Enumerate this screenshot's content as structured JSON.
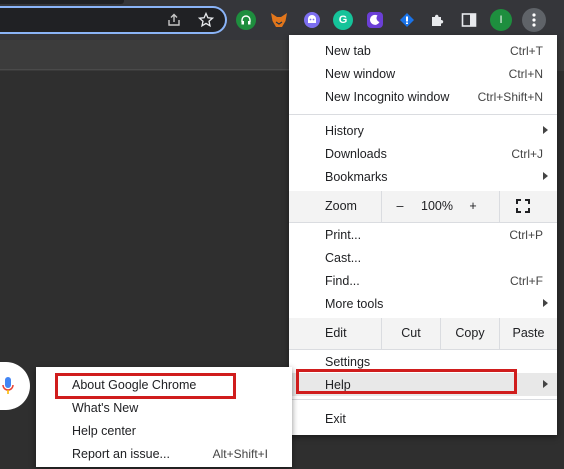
{
  "menu": {
    "items1": [
      {
        "label": "New tab",
        "shortcut": "Ctrl+T"
      },
      {
        "label": "New window",
        "shortcut": "Ctrl+N"
      },
      {
        "label": "New Incognito window",
        "shortcut": "Ctrl+Shift+N"
      }
    ],
    "items2": [
      {
        "label": "History",
        "shortcut": ""
      },
      {
        "label": "Downloads",
        "shortcut": "Ctrl+J"
      },
      {
        "label": "Bookmarks",
        "shortcut": ""
      }
    ],
    "zoom": {
      "label": "Zoom",
      "minus": "–",
      "value": "100%",
      "plus": "+"
    },
    "items3": [
      {
        "label": "Print...",
        "shortcut": "Ctrl+P"
      },
      {
        "label": "Cast...",
        "shortcut": ""
      },
      {
        "label": "Find...",
        "shortcut": "Ctrl+F"
      },
      {
        "label": "More tools",
        "shortcut": ""
      }
    ],
    "edit": {
      "label": "Edit",
      "cut": "Cut",
      "copy": "Copy",
      "paste": "Paste"
    },
    "settings": "Settings",
    "help": "Help",
    "exit": "Exit"
  },
  "help_submenu": [
    {
      "label": "About Google Chrome",
      "shortcut": ""
    },
    {
      "label": "What's New",
      "shortcut": ""
    },
    {
      "label": "Help center",
      "shortcut": ""
    },
    {
      "label": "Report an issue...",
      "shortcut": "Alt+Shift+I"
    }
  ],
  "toolbar": {
    "grammarly_letter": "G",
    "profile_letter": "I"
  },
  "icons": [
    "share-icon",
    "bookmark-star-icon",
    "extension-headphones-icon",
    "metamask-fox-icon",
    "extension-ghost-icon",
    "grammarly-icon",
    "extension-moon-icon",
    "extension-shield-icon",
    "extensions-puzzle-icon",
    "side-panel-icon",
    "profile-avatar",
    "chrome-menu-icon",
    "microphone-icon",
    "fullscreen-icon"
  ],
  "colors": {
    "highlight_box": "#d01d1d",
    "toolbar_bg": "#35363a",
    "profile_avatar": "#1e8e3e",
    "grammarly": "#15c39a"
  }
}
